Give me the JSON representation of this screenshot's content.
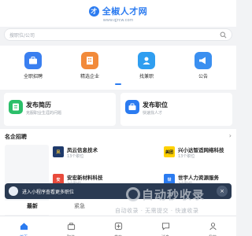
{
  "header": {
    "logo_mark": "才",
    "brand": "全椒人才网",
    "url": "www.qjrcw.com"
  },
  "search": {
    "placeholder": "搜职位/公司"
  },
  "shortcuts": [
    {
      "label": "全职招聘",
      "icon": "briefcase-icon"
    },
    {
      "label": "精选企业",
      "icon": "building-icon"
    },
    {
      "label": "找兼职",
      "icon": "handshake-icon"
    },
    {
      "label": "公告",
      "icon": "megaphone-icon"
    }
  ],
  "cards": [
    {
      "title": "发布简历",
      "subtitle": "克服职业生涯的问题",
      "icon": "resume-icon"
    },
    {
      "title": "发布职位",
      "subtitle": "快速找人才",
      "icon": "post-job-icon"
    }
  ],
  "companies": {
    "title": "名企招聘",
    "more": "›",
    "items": [
      {
        "name": "凤云信息技术",
        "positions": "13个职位",
        "logo": "凤"
      },
      {
        "name": "兴小达智适网络科技",
        "positions": "13个职位",
        "logo": "美团"
      },
      {
        "name": "安宏新材料科技",
        "positions": "2个职位",
        "logo": "安"
      },
      {
        "name": "世宇人力资源服务",
        "positions": "2个职位",
        "logo": "世"
      }
    ]
  },
  "toast": {
    "text": "进入小程序查看更多职位",
    "close": "×"
  },
  "tags": {
    "latest": "最新",
    "urgent": "紧急"
  },
  "watermark": {
    "main": "自动秒收录",
    "sub": "自动收录 · 无需提交 · 快速收录"
  },
  "tabbar": [
    {
      "label": "首页",
      "icon": "home-icon",
      "active": true
    },
    {
      "label": "职位",
      "icon": "job-icon",
      "active": false
    },
    {
      "label": "发布",
      "icon": "plus-icon",
      "active": false
    },
    {
      "label": "消息",
      "icon": "message-icon",
      "active": false
    },
    {
      "label": "我的",
      "icon": "user-icon",
      "active": false
    }
  ],
  "colors": {
    "accent": "#2b7bf0",
    "orange": "#f07a2b",
    "green": "#2bbf6a",
    "toast_bg": "#2a3a52"
  }
}
